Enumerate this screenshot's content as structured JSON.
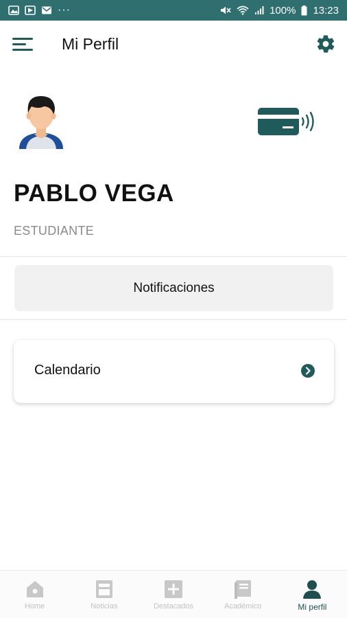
{
  "status_bar": {
    "battery": "100%",
    "time": "13:23"
  },
  "app_bar": {
    "title": "Mi Perfil"
  },
  "profile": {
    "name": "PABLO VEGA",
    "role": "ESTUDIANTE"
  },
  "actions": {
    "notifications_label": "Notificaciones",
    "calendar_label": "Calendario"
  },
  "bottom_nav": {
    "items": [
      {
        "label": "Home",
        "icon": "home-icon",
        "active": false
      },
      {
        "label": "Noticias",
        "icon": "news-icon",
        "active": false
      },
      {
        "label": "Destacados",
        "icon": "plus-box-icon",
        "active": false
      },
      {
        "label": "Académico",
        "icon": "book-icon",
        "active": false
      },
      {
        "label": "Mi perfil",
        "icon": "person-icon",
        "active": true
      }
    ]
  },
  "colors": {
    "status_bar": "#2f6f6f",
    "accent": "#1f5b5b",
    "inactive": "#c2c2c2"
  }
}
